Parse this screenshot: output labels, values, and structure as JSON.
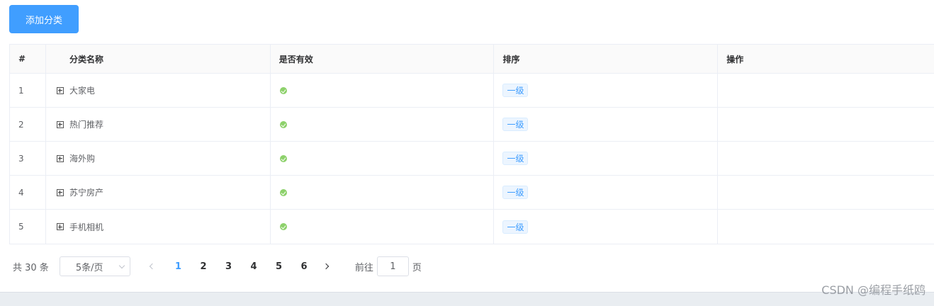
{
  "toolbar": {
    "add_label": "添加分类"
  },
  "table": {
    "headers": {
      "index": "#",
      "name": "分类名称",
      "valid": "是否有效",
      "sort": "排序",
      "ops": "操作"
    },
    "rows": [
      {
        "index": "1",
        "name": "大家电",
        "level": "一级"
      },
      {
        "index": "2",
        "name": "热门推荐",
        "level": "一级"
      },
      {
        "index": "3",
        "name": "海外购",
        "level": "一级"
      },
      {
        "index": "4",
        "name": "苏宁房产",
        "level": "一级"
      },
      {
        "index": "5",
        "name": "手机相机",
        "level": "一级"
      }
    ]
  },
  "pagination": {
    "total_text": "共 30 条",
    "page_size": "5条/页",
    "pages": [
      "1",
      "2",
      "3",
      "4",
      "5",
      "6"
    ],
    "current_page": "1",
    "goto_label": "前往",
    "goto_value": "1",
    "goto_suffix": "页"
  },
  "watermark": "CSDN @编程手纸鸥",
  "colors": {
    "primary": "#409eff",
    "success": "#67c23a"
  }
}
